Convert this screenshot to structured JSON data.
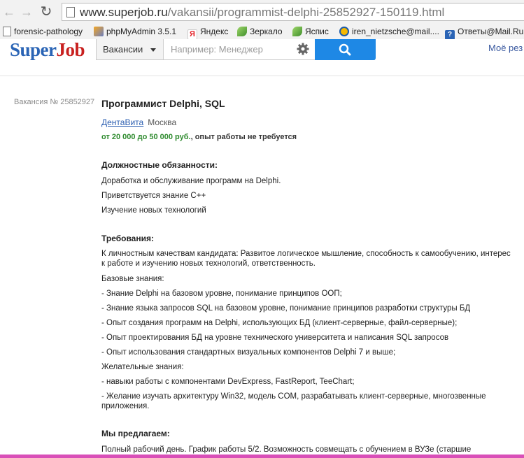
{
  "browser": {
    "url_domain": "www.superjob.ru",
    "url_path": "/vakansii/programmist-delphi-25852927-150119.html",
    "bookmarks": [
      {
        "label": "forensic-pathology",
        "icon": "document-icon"
      },
      {
        "label": "phpMyAdmin 3.5.1",
        "icon": "phpmyadmin-icon"
      },
      {
        "label": "Яндекс",
        "icon": "yandex-icon"
      },
      {
        "label": "Зеркало",
        "icon": "mirror-icon"
      },
      {
        "label": "Яспис",
        "icon": "yaspis-icon"
      },
      {
        "label": "iren_nietzsche@mail....",
        "icon": "mail-icon"
      },
      {
        "label": "Ответы@Mail.Ru",
        "icon": "answers-icon"
      }
    ]
  },
  "header": {
    "logo_part1": "Super",
    "logo_part2": "Job",
    "category_label": "Вакансии",
    "search_placeholder": "Например: Менеджер",
    "my_resume_label": "Моё рез"
  },
  "vacancy": {
    "number_label": "Вакансия № 25852927",
    "title": "Программист Delphi, SQL",
    "company": "ДентаВита",
    "city": "Москва",
    "salary": "от 20 000 до 50 000 руб.",
    "experience": ", опыт работы не требуется",
    "duties_heading": "Должностные обязанности:",
    "duties": [
      "Доработка и обслуживание программ на Delphi.",
      "Приветствуется знание С++",
      "Изучение новых технологий"
    ],
    "requirements_heading": "Требования:",
    "requirements_intro": "К личностным качествам кандидата: Развитое логическое мышление, способность к самообучению, интерес к работе и изучению новых технологий, ответственность.",
    "basic_knowledge_label": "Базовые знания:",
    "basic_knowledge": [
      "- Знание Delphi на базовом уровне, понимание принципов ООП;",
      "- Знание языка запросов SQL на базовом уровне, понимание принципов разработки структуры БД",
      "- Опыт создания программ на Delphi, использующих БД (клиент-серверные, файл-серверные);",
      "- Опыт проектирования БД на уровне технического университета и написания SQL запросов",
      "- Опыт использования стандартных визуальных компонентов Delphi 7 и выше;"
    ],
    "desired_knowledge_label": "Желательные знания:",
    "desired_knowledge": [
      "- навыки работы с компонентами DevExpress, FastReport, TeeChart;",
      "- Желание изучать архитектуру Win32, модель COM, разрабатывать клиент-серверные, многозвенные приложения."
    ],
    "offer_heading": "Мы предлагаем:",
    "offer_text": "Полный рабочий день. График работы 5/2. Возможность совмещать с обучением в ВУЗе (старшие"
  },
  "colors": {
    "logo_blue": "#2a64b5",
    "logo_red": "#c8201f",
    "search_button": "#1e88e5",
    "salary_green": "#2d8a2d",
    "link_blue": "#2a5db0"
  }
}
